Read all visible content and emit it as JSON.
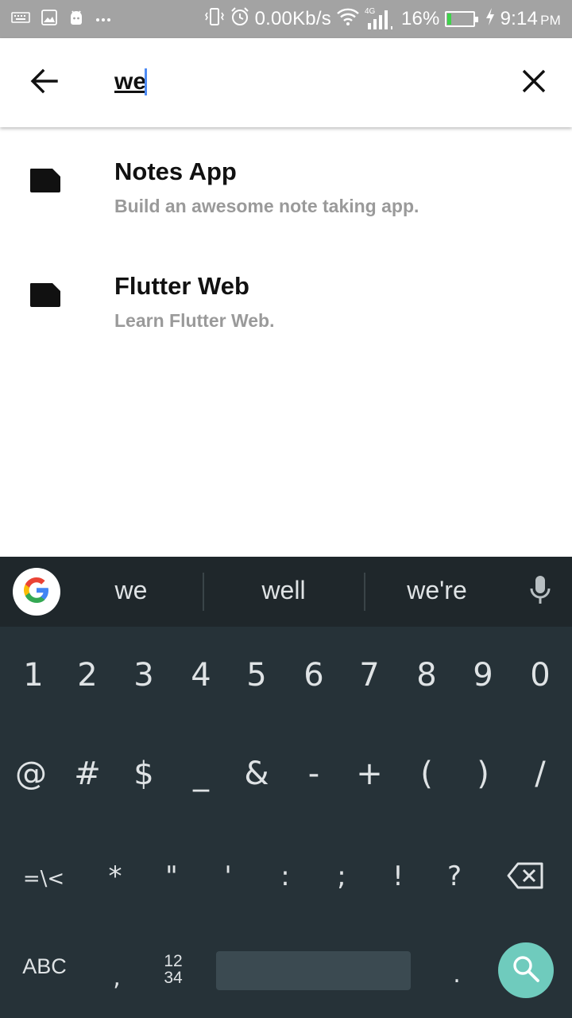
{
  "status_bar": {
    "network_speed": "0.00Kb/s",
    "network_type": "4G",
    "battery_percent": "16%",
    "battery_level": 0.16,
    "time": "9:14",
    "ampm": "PM"
  },
  "search": {
    "query": "we"
  },
  "results": [
    {
      "title": "Notes App",
      "subtitle": "Build an awesome note taking app."
    },
    {
      "title": "Flutter Web",
      "subtitle": "Learn Flutter Web."
    }
  ],
  "keyboard": {
    "suggestions": [
      "we",
      "well",
      "we're"
    ],
    "row1": [
      "1",
      "2",
      "3",
      "4",
      "5",
      "6",
      "7",
      "8",
      "9",
      "0"
    ],
    "row2": [
      "@",
      "#",
      "$",
      "_",
      "&",
      "-",
      "+",
      "(",
      ")",
      "/"
    ],
    "row3": [
      "=\\<",
      "*",
      "\"",
      "'",
      ":",
      ";",
      "!",
      "?"
    ],
    "abc_label": "ABC",
    "comma_label": ",",
    "num_label_top": "12",
    "num_label_bottom": "34",
    "period_label": "."
  },
  "colors": {
    "status_bar": "#a3a3a3",
    "keyboard_bg": "#263238",
    "suggestion_bg": "#1f272b",
    "search_key": "#6fcbbd",
    "caret": "#4d8bf5",
    "battery_fill": "#3fd34b"
  }
}
